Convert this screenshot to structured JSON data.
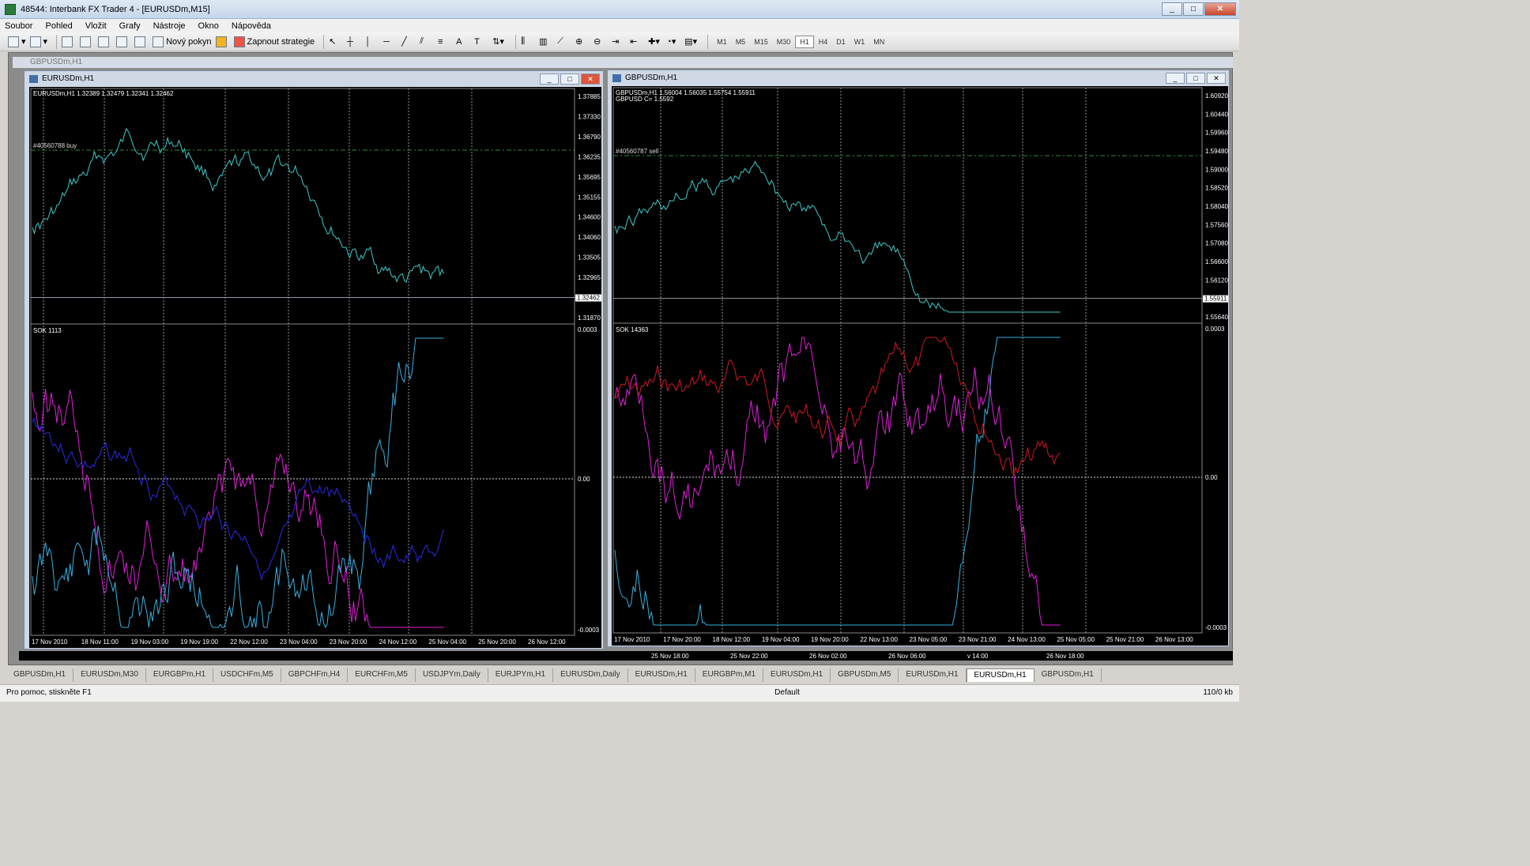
{
  "app": {
    "title": "48544: Interbank FX Trader 4 - [EURUSDm,M15]",
    "controls": [
      "_",
      "□",
      "✕"
    ]
  },
  "menu": [
    "Soubor",
    "Pohled",
    "Vložit",
    "Grafy",
    "Nástroje",
    "Okno",
    "Nápověda"
  ],
  "toolbar": {
    "new_order": "Nový pokyn",
    "expert": "Zapnout strategie",
    "timeframes": [
      "M1",
      "M5",
      "M15",
      "M30",
      "H1",
      "H4",
      "D1",
      "W1",
      "MN"
    ],
    "active_timeframe": "H1"
  },
  "background_window": {
    "title": "GBPUSDm,H1"
  },
  "left_chart": {
    "window_title": "EURUSDm,H1",
    "header": "EURUSDm,H1  1.32389 1.32479 1.32341 1.32462",
    "order_label": "#40560788 buy",
    "price_scale": [
      "1.37885",
      "1.37330",
      "1.36790",
      "1.36235",
      "1.35695",
      "1.35155",
      "1.34600",
      "1.34060",
      "1.33505",
      "1.32965",
      "1.32462",
      "1.31870"
    ],
    "current_price": "1.32462",
    "indicator_header": "SOK 1113",
    "indicator_scale": [
      "0.0003",
      "0.00",
      "-0.0003"
    ],
    "time_axis": [
      "17 Nov 2010",
      "18 Nov 11:00",
      "19 Nov 03:00",
      "19 Nov 19:00",
      "22 Nov 12:00",
      "23 Nov 04:00",
      "23 Nov 20:00",
      "24 Nov 12:00",
      "25 Nov 04:00",
      "25 Nov 20:00",
      "26 Nov 12:00"
    ]
  },
  "right_chart": {
    "window_title": "GBPUSDm,H1",
    "header": "GBPUSDm,H1  1.56004 1.56035 1.55754 1.55911",
    "header2": "GBPUSD C= 1.5592",
    "order_label": "#40560787 sell",
    "price_scale": [
      "1.60920",
      "1.60440",
      "1.59960",
      "1.59480",
      "1.59000",
      "1.58520",
      "1.58040",
      "1.57560",
      "1.57080",
      "1.56600",
      "1.56120",
      "1.55911",
      "1.55640"
    ],
    "current_price": "1.55911",
    "indicator_header": "SOK 14363",
    "indicator_scale": [
      "0.0003",
      "0.00",
      "-0.0003"
    ],
    "time_axis": [
      "17 Nov 2010",
      "17 Nov 20:00",
      "18 Nov 12:00",
      "19 Nov 04:00",
      "19 Nov 20:00",
      "22 Nov 13:00",
      "23 Nov 05:00",
      "23 Nov 21:00",
      "24 Nov 13:00",
      "25 Nov 05:00",
      "25 Nov 21:00",
      "26 Nov 13:00"
    ]
  },
  "bottom_strip": [
    "25 Nov 18:00",
    "25 Nov 22:00",
    "26 Nov 02:00",
    "26 Nov 06:00",
    "v 14:00",
    "26 Nov 18:00"
  ],
  "tabs": [
    "GBPUSDm,H1",
    "EURUSDm,M30",
    "EURGBPm,H1",
    "USDCHFm,M5",
    "GBPCHFm,H4",
    "EURCHFm,M5",
    "USDJPYm,Daily",
    "EURJPYm,H1",
    "EURUSDm,Daily",
    "EURUSDm,H1",
    "EURGBPm,M1",
    "EURUSDm,H1",
    "GBPUSDm,M5",
    "EURUSDm,H1",
    "EURUSDm,H1",
    "GBPUSDm,H1"
  ],
  "active_tab_index": 14,
  "status": {
    "help": "Pro pomoc, stiskněte F1",
    "profile": "Default",
    "traffic": "110/0 kb"
  },
  "colors": {
    "price_line": "#40c8c8",
    "order_line": "#2e8b2e",
    "sok_magenta": "#e020d8",
    "sok_blue": "#2a2ae0",
    "sok_cyan": "#3aaee0",
    "sok_red": "#d01820"
  }
}
